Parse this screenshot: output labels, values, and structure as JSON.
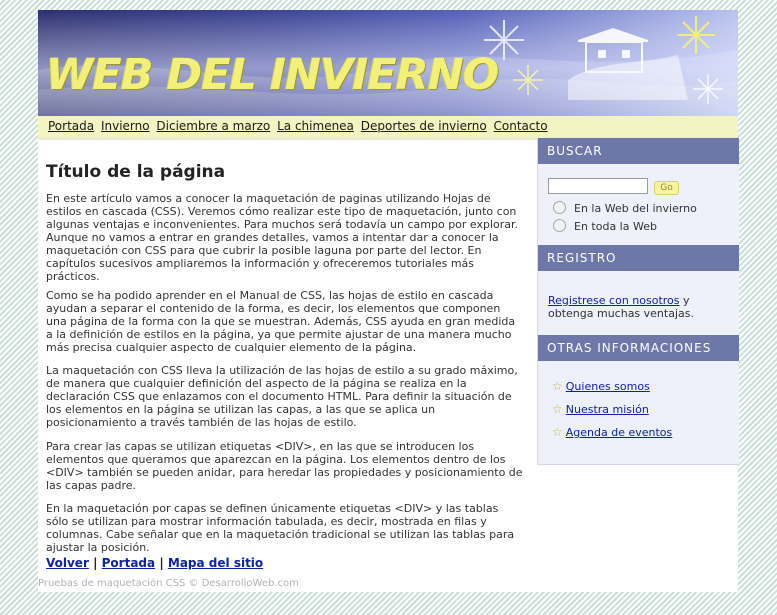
{
  "colors": {
    "page_background": "#dfeee9",
    "banner_sky": "#3a3f8a",
    "banner_title": "#f3f07a",
    "nav_background": "#f4f3c2",
    "sidebar_background": "#eef0fa",
    "sidebar_header": "#6e78a8",
    "link": "#0c22a8"
  },
  "banner": {
    "title": "WEB DEL INVIERNO",
    "icons": [
      "snowflake-icon",
      "snowflake-icon",
      "snowflake-icon",
      "snowflake-icon",
      "house-icon"
    ]
  },
  "nav": {
    "items": [
      {
        "label": "Portada"
      },
      {
        "label": "Invierno"
      },
      {
        "label": "Diciembre a marzo"
      },
      {
        "label": "La chimenea"
      },
      {
        "label": "Deportes de invierno"
      },
      {
        "label": "Contacto"
      }
    ]
  },
  "main": {
    "title": "Título de la página",
    "paragraphs": [
      "En este artículo vamos a conocer la maquetación de paginas utilizando Hojas de estilos en cascada (CSS). Veremos cómo realizar este tipo de maquetación, junto con algunas ventajas e inconvenientes. Para muchos será todavía un campo por explorar. Aunque no vamos a entrar en grandes detalles, vamos a intentar dar a conocer la maquetación con CSS para que cubrir la posible laguna por parte del lector. En capítulos sucesivos ampliaremos la información y ofreceremos tutoriales más prácticos.",
      "Como se ha podido aprender en el Manual de CSS, las hojas de estilo en cascada ayudan a separar el contenido de la forma, es decir, los elementos que componen una página de la forma con la que se muestran. Además, CSS ayuda en gran medida a la definición de estilos en la página, ya que permite ajustar de una manera mucho más precisa cualquier aspecto de cualquier elemento de la página.",
      "La maquetación con CSS lleva la utilización de las hojas de estilo a su grado máximo, de manera que cualquier definición del aspecto de la página se realiza en la declaración CSS que enlazamos con el documento HTML. Para definir la situación de los elementos en la página se utilizan las capas, a las que se aplica un posicionamiento a través también de las hojas de estilo.",
      "Para crear las capas se utilizan etiquetas <DIV>, en las que se introducen los elementos que queramos que aparezcan en la página. Los elementos dentro de los <DIV> también se pueden anidar, para heredar las propiedades y posicionamiento de las capas padre.",
      "En la maquetación por capas se definen únicamente etiquetas <DIV> y las tablas sólo se utilizan para mostrar información tabulada, es decir, mostrada en filas y columnas. Cabe señalar que en la maquetación tradicional se utilizan las tablas para ajustar la posición."
    ],
    "bottom_links": [
      "Volver",
      "Portada",
      "Mapa del sitio"
    ],
    "separator": "|"
  },
  "sidebar": {
    "search": {
      "heading": "BUSCAR",
      "input_value": "",
      "button_label": "Go",
      "options": [
        "En la Web del invierno",
        "En toda la Web"
      ]
    },
    "register": {
      "heading": "REGISTRO",
      "link": "Registrese con nosotros",
      "text": " y obtenga muchas ventajas."
    },
    "info": {
      "heading": "OTRAS INFORMACIONES",
      "items": [
        "Quienes somos",
        "Nuestra misión",
        "Agenda de eventos"
      ]
    }
  },
  "footer": {
    "text": "Pruebas de maquetación CSS © DesarrolloWeb.com"
  }
}
